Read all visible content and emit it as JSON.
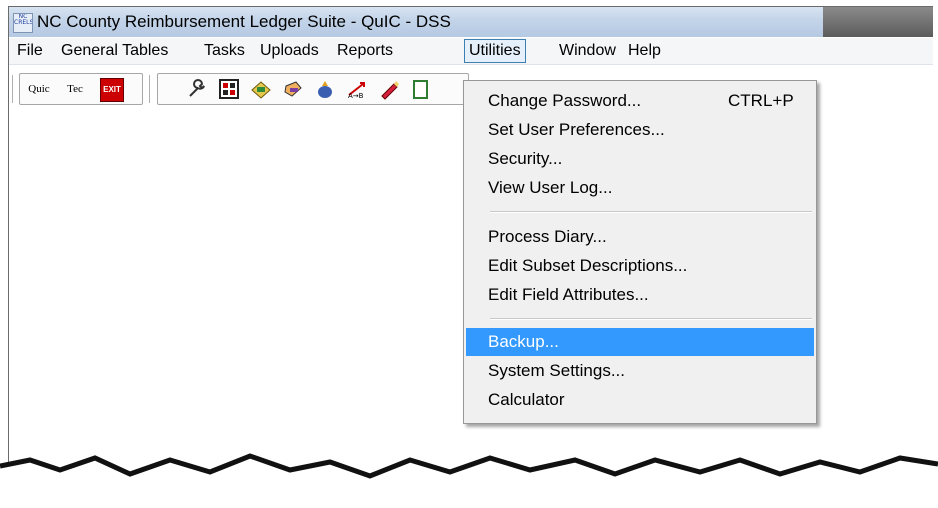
{
  "window": {
    "title": "NC County Reimbursement Ledger Suite - QuIC - DSS",
    "icon_text": "NC CRELS"
  },
  "menubar": {
    "items": [
      "File",
      "General Tables",
      "Tasks",
      "Uploads",
      "Reports",
      "Utilities",
      "Window",
      "Help"
    ],
    "active": "Utilities"
  },
  "toolbar": {
    "group1": [
      "Quic",
      "Tec",
      "EXIT"
    ],
    "group2_icons": [
      "wrench-icon",
      "calculator-icon",
      "folder-money-icon",
      "hand-tool-icon",
      "money-bag-icon",
      "transfer-icon",
      "pencil-icon",
      "document-icon"
    ]
  },
  "utilities_menu": {
    "items": [
      {
        "label": "Change Password...",
        "shortcut": "CTRL+P"
      },
      {
        "label": "Set User Preferences...",
        "shortcut": ""
      },
      {
        "label": "Security...",
        "shortcut": ""
      },
      {
        "label": "View User Log...",
        "shortcut": ""
      },
      {
        "label": "Process Diary...",
        "shortcut": ""
      },
      {
        "label": "Edit Subset Descriptions...",
        "shortcut": ""
      },
      {
        "label": "Edit Field Attributes...",
        "shortcut": ""
      },
      {
        "label": "Backup...",
        "shortcut": ""
      },
      {
        "label": "System Settings...",
        "shortcut": ""
      },
      {
        "label": "Calculator",
        "shortcut": ""
      }
    ],
    "highlighted": "Backup...",
    "highlight_color": "#3399ff"
  }
}
